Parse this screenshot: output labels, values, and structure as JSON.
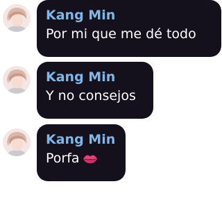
{
  "messages": [
    {
      "sender": "Kang Min",
      "text": "Por mi que me dé todo",
      "emoji": null
    },
    {
      "sender": "Kang Min",
      "text": "Y no consejos",
      "emoji": null
    },
    {
      "sender": "Kang Min",
      "text": "Porfa",
      "emoji": "kiss-lips-icon"
    }
  ],
  "colors": {
    "bubble": "#15111c",
    "sender": "#7fb7e8",
    "text": "#ffffff"
  }
}
